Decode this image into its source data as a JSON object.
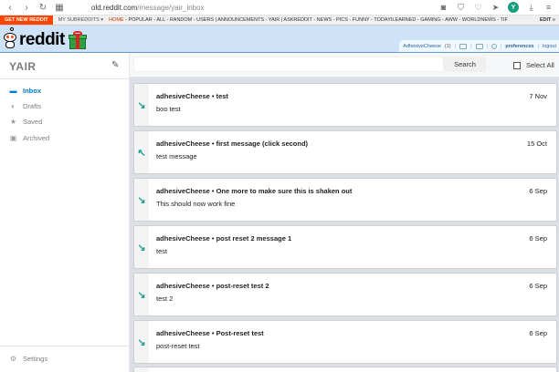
{
  "browser": {
    "url_host": "old.reddit.com",
    "url_path": "/message/yair_inbox",
    "profile_initial": "Y",
    "colors": {
      "profile": "#1a9e7e"
    }
  },
  "srbar": {
    "get_new": "GET NEW REDDIT",
    "my_subreddits": "MY SUBREDDITS ▾",
    "links_home": "HOME",
    "links_rest": " - POPULAR - ALL - RANDOM - USERS | ANNOUNCEMENTS - YAIR | ASKREDDIT - NEWS - PICS - FUNNY - TODAYILEARNED - GAMING - AWW - WORLDNEWS - TIF",
    "edit": "EDIT »"
  },
  "header": {
    "wordmark": "reddit",
    "username": "AdhesiveCheese",
    "karma": "(1)",
    "preferences": "preferences",
    "logout": "logout",
    "colors": {
      "header_bg": "#cee3f8",
      "accent": "#ff4500"
    }
  },
  "sidebar": {
    "title": "YAIR",
    "items": [
      {
        "label": "Inbox",
        "icon": "inbox-icon",
        "active": true
      },
      {
        "label": "Drafts",
        "icon": "drafts-icon",
        "active": false
      },
      {
        "label": "Saved",
        "icon": "star-icon",
        "active": false
      },
      {
        "label": "Archived",
        "icon": "archive-icon",
        "active": false
      }
    ],
    "settings": "Settings",
    "colors": {
      "active": "#0079d3"
    }
  },
  "toolbar": {
    "search_label": "Search",
    "select_all": "Select All"
  },
  "messages": [
    {
      "subject": "adhesiveCheese • test",
      "date": "7 Nov",
      "body": "boo test",
      "direction": "incoming"
    },
    {
      "subject": "adhesiveCheese • first message (click second)",
      "date": "15 Oct",
      "body": "test message",
      "direction": "outgoing"
    },
    {
      "subject": "adhesiveCheese • One more to make sure this is shaken out",
      "date": "6 Sep",
      "body": "This should now work fine",
      "direction": "incoming"
    },
    {
      "subject": "adhesiveCheese • post reset 2 message 1",
      "date": "6 Sep",
      "body": "test",
      "direction": "incoming"
    },
    {
      "subject": "adhesiveCheese • post-reset test 2",
      "date": "6 Sep",
      "body": "test 2",
      "direction": "incoming"
    },
    {
      "subject": "adhesiveCheese • Post-reset test",
      "date": "6 Sep",
      "body": "post-reset test",
      "direction": "incoming"
    }
  ],
  "colors": {
    "arrow": "#1fa095",
    "main_bg": "#dae0e6"
  }
}
